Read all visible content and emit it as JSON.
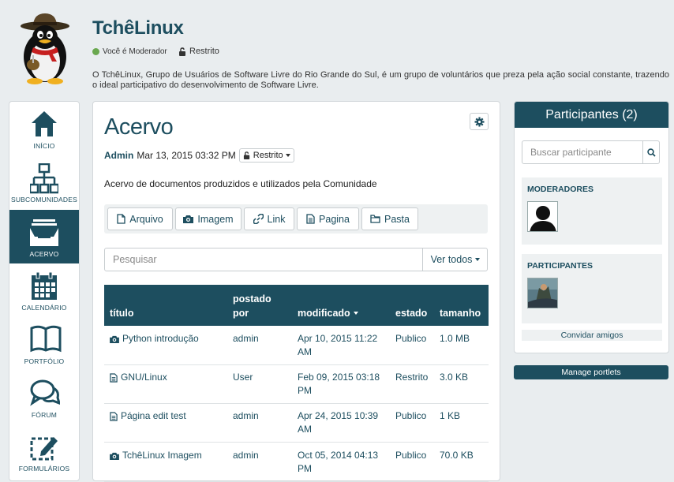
{
  "header": {
    "title": "TchêLinux",
    "moderator_badge": "Você é Moderador",
    "privacy": "Restrito",
    "description": "O TchêLinux, Grupo de Usuários de Software Livre do Rio Grande do Sul, é um grupo de voluntários que preza pela ação social constante, trazendo o ideal participativo do desenvolvimento de Software Livre."
  },
  "nav": {
    "items": [
      {
        "label": "INÍCIO",
        "icon": "home-icon"
      },
      {
        "label": "SUBCOMUNIDADES",
        "icon": "sitemap-icon"
      },
      {
        "label": "ACERVO",
        "icon": "archive-icon",
        "active": true
      },
      {
        "label": "CALENDÁRIO",
        "icon": "calendar-icon"
      },
      {
        "label": "PORTFÓLIO",
        "icon": "book-icon"
      },
      {
        "label": "FÓRUM",
        "icon": "chat-icon"
      },
      {
        "label": "FORMULÁRIOS",
        "icon": "form-edit-icon"
      }
    ]
  },
  "main": {
    "title": "Acervo",
    "author": "Admin",
    "date": "Mar 13, 2015 03:32 PM",
    "privacy": "Restrito",
    "description": "Acervo de documentos produzidos e utilizados pela Comunidade",
    "add_buttons": [
      "Arquivo",
      "Imagem",
      "Link",
      "Pagina",
      "Pasta"
    ],
    "search_placeholder": "Pesquisar",
    "view_filter": "Ver todos",
    "table": {
      "headers": {
        "title": "título",
        "posted_1": "postado",
        "posted_2": "por",
        "modified": "modificado",
        "state": "estado",
        "size": "tamanho"
      },
      "rows": [
        {
          "title": "Python introdução",
          "type": "image",
          "user": "admin",
          "modified_1": "Apr 10, 2015 11:22",
          "modified_2": "AM",
          "state": "Publico",
          "size": "1.0 MB"
        },
        {
          "title": "GNU/Linux",
          "type": "page",
          "user": "User",
          "modified_1": "Feb 09, 2015 03:18",
          "modified_2": "PM",
          "state": "Restrito",
          "size": "3.0 KB"
        },
        {
          "title": "Página edit test",
          "type": "page",
          "user": "admin",
          "modified_1": "Apr 24, 2015 10:39",
          "modified_2": "AM",
          "state": "Publico",
          "size": "1 KB"
        },
        {
          "title": "TchêLinux Imagem",
          "type": "image",
          "user": "admin",
          "modified_1": "Oct 05, 2014 04:13",
          "modified_2": "PM",
          "state": "Publico",
          "size": "70.0 KB"
        }
      ]
    }
  },
  "participants": {
    "title": "Participantes (2)",
    "search_placeholder": "Buscar participante",
    "moderators_label": "MODERADORES",
    "participants_label": "PARTICIPANTES",
    "invite": "Convidar amigos"
  },
  "manage_portlets": "Manage portlets",
  "colors": {
    "primary": "#1d4e5f",
    "background": "#e9edef"
  }
}
